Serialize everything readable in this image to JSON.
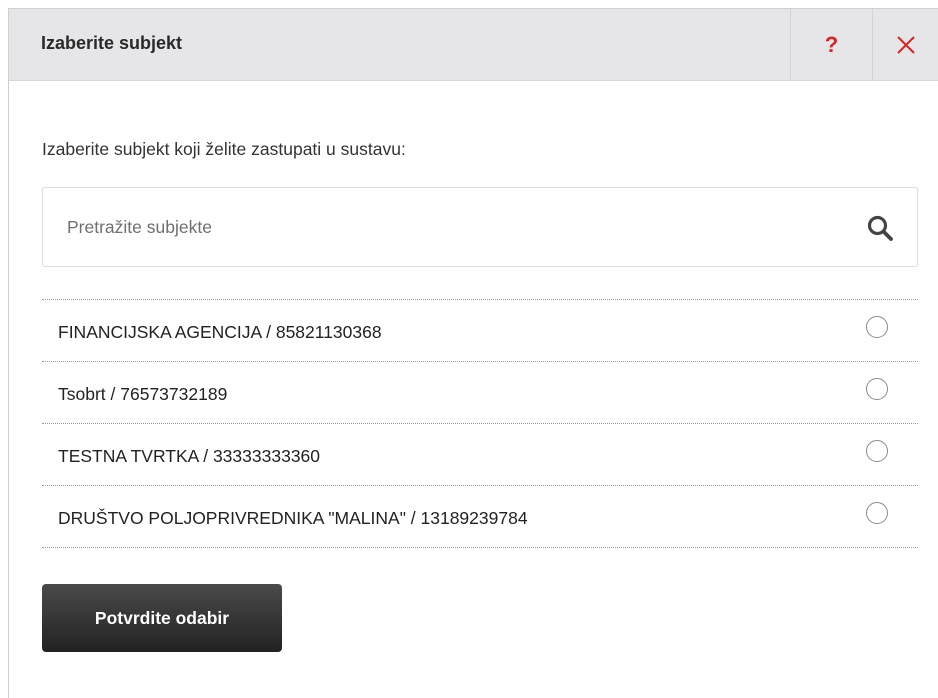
{
  "dialog": {
    "title": "Izaberite subjekt",
    "help_label": "?",
    "close_icon": "close-icon",
    "accent_color": "#d4262b"
  },
  "content": {
    "intro": "Izaberite subjekt koji želite zastupati u sustavu:",
    "search": {
      "placeholder": "Pretražite subjekte",
      "value": "",
      "icon": "search-icon"
    },
    "subjects": [
      {
        "label": "FINANCIJSKA AGENCIJA / 85821130368",
        "selected": false
      },
      {
        "label": "Tsobrt / 76573732189",
        "selected": false
      },
      {
        "label": "TESTNA TVRTKA / 33333333360",
        "selected": false
      },
      {
        "label": "DRUŠTVO POLJOPRIVREDNIKA \"MALINA\" / 13189239784",
        "selected": false
      }
    ],
    "confirm_label": "Potvrdite odabir"
  }
}
